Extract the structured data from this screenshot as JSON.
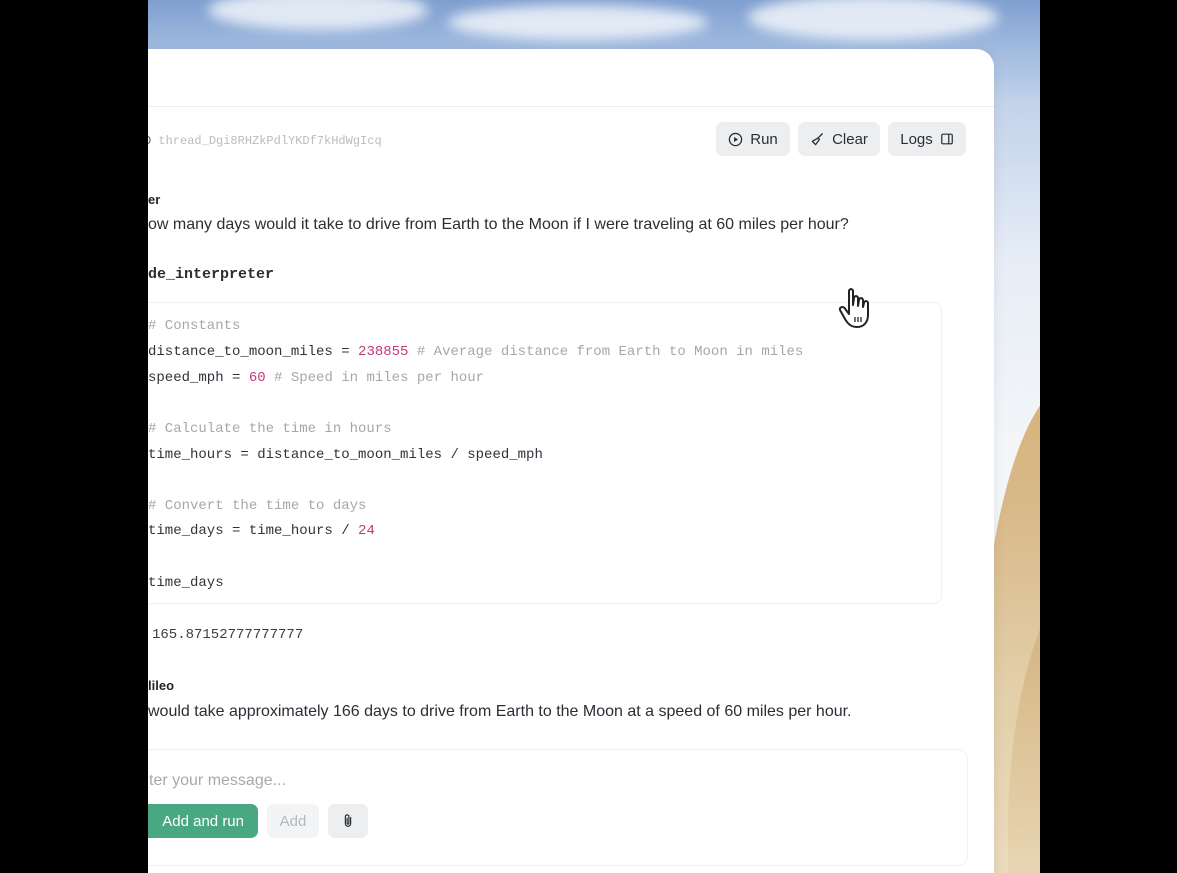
{
  "thread": {
    "label_fragment": "D",
    "thread_id": "thread_Dgi8RHZkPdlYKDf7kHdWgIcq"
  },
  "toolbar": {
    "run_label": "Run",
    "clear_label": "Clear",
    "logs_label": "Logs"
  },
  "messages": {
    "user_role": "er",
    "user_text": "ow many days would it take to drive from Earth to the Moon if I were traveling at 60 miles per hour?",
    "tool_name": "de_interpreter",
    "code": {
      "l1_comment": "# Constants",
      "l2_code": "distance_to_moon_miles = ",
      "l2_num": "238855",
      "l2_comment": " # Average distance from Earth to Moon in miles",
      "l3_code": "speed_mph = ",
      "l3_num": "60",
      "l3_comment": " # Speed in miles per hour",
      "l4_comment": "# Calculate the time in hours",
      "l5_code": "time_hours = distance_to_moon_miles / speed_mph",
      "l6_comment": "# Convert the time to days",
      "l7_code": "time_days = time_hours / ",
      "l7_num": "24",
      "l8_code": "time_days"
    },
    "output": "165.87152777777777",
    "assistant_role": "lileo",
    "assistant_text": "would take approximately 166 days to drive from Earth to the Moon at a speed of 60 miles per hour."
  },
  "composer": {
    "placeholder": "ter your message...",
    "add_and_run_label": "Add and run",
    "add_label": "Add"
  },
  "colors": {
    "primary": "#49a882",
    "number": "#c0397a",
    "comment": "#a4a7ad"
  }
}
